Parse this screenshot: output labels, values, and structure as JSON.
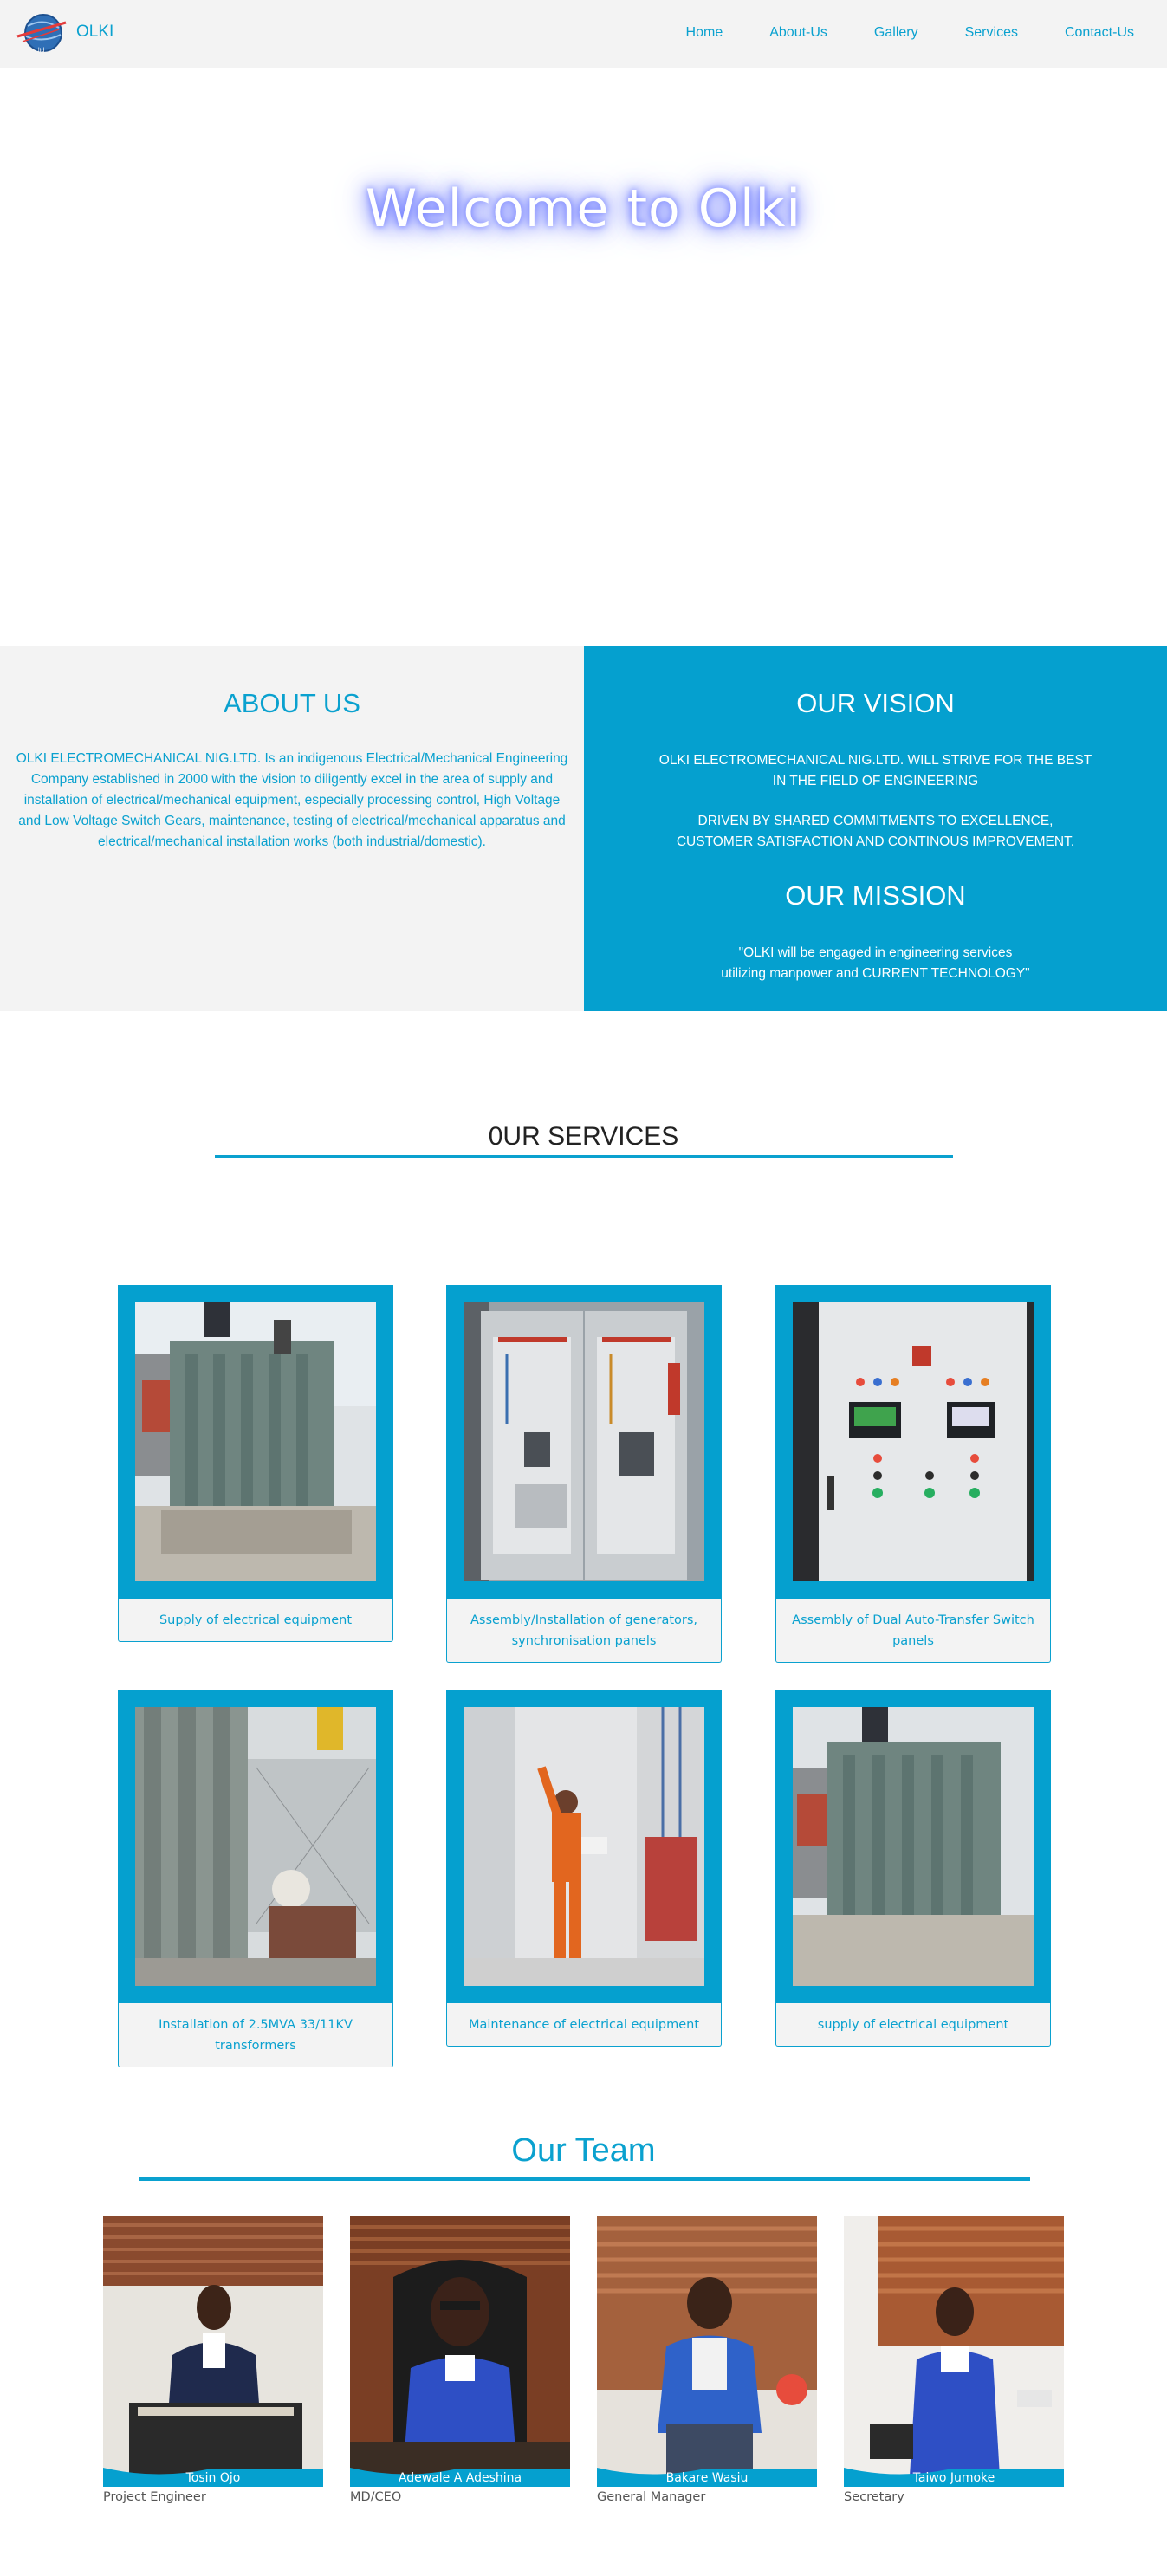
{
  "nav": {
    "brand": "OLKI",
    "links": [
      "Home",
      "About-Us",
      "Gallery",
      "Services",
      "Contact-Us"
    ]
  },
  "hero": {
    "title": "Welcome to Olki"
  },
  "about": {
    "heading": "ABOUT US",
    "text": "OLKI ELECTROMECHANICAL NIG.LTD. Is an indigenous Electrical/Mechanical Engineering Company established in 2000 with the vision to diligently excel in the area of supply and installation of electrical/mechanical equipment, especially processing control, High Voltage and Low Voltage Switch Gears, maintenance, testing of electrical/mechanical apparatus and electrical/mechanical installation works (both industrial/domestic)."
  },
  "vision": {
    "heading": "OUR VISION",
    "line1": "OLKI ELECTROMECHANICAL NIG.LTD. WILL STRIVE FOR THE BEST",
    "line2": "IN THE FIELD OF ENGINEERING",
    "line3": "DRIVEN BY SHARED COMMITMENTS TO EXCELLENCE,",
    "line4": "CUSTOMER SATISFACTION AND CONTINOUS IMPROVEMENT."
  },
  "mission": {
    "heading": "OUR MISSION",
    "line1": "\"OLKI will be engaged in engineering services",
    "line2": "utilizing manpower and CURRENT TECHNOLOGY\""
  },
  "services": {
    "heading": "0UR SERVICES",
    "items": [
      "Supply of electrical equipment",
      "Assembly/Installation of generators, synchronisation panels",
      "Assembly of Dual Auto-Transfer Switch panels",
      "Installation of 2.5MVA 33/11KV transformers",
      "Maintenance of electrical equipment",
      "supply of electrical equipment"
    ]
  },
  "team": {
    "heading": "Our Team",
    "members": [
      {
        "name": "Tosin Ojo",
        "role": "Project Engineer"
      },
      {
        "name": "Adewale A Adeshina",
        "role": "MD/CEO"
      },
      {
        "name": "Bakare Wasiu",
        "role": "General Manager"
      },
      {
        "name": "Taiwo Jumoke",
        "role": "Secretary"
      }
    ]
  },
  "colors": {
    "accent": "#05a0cf",
    "light_bg": "#f3f3f3",
    "hero_glow": "#6f7cff"
  },
  "icons": {
    "logo": "globe-logo-icon"
  }
}
